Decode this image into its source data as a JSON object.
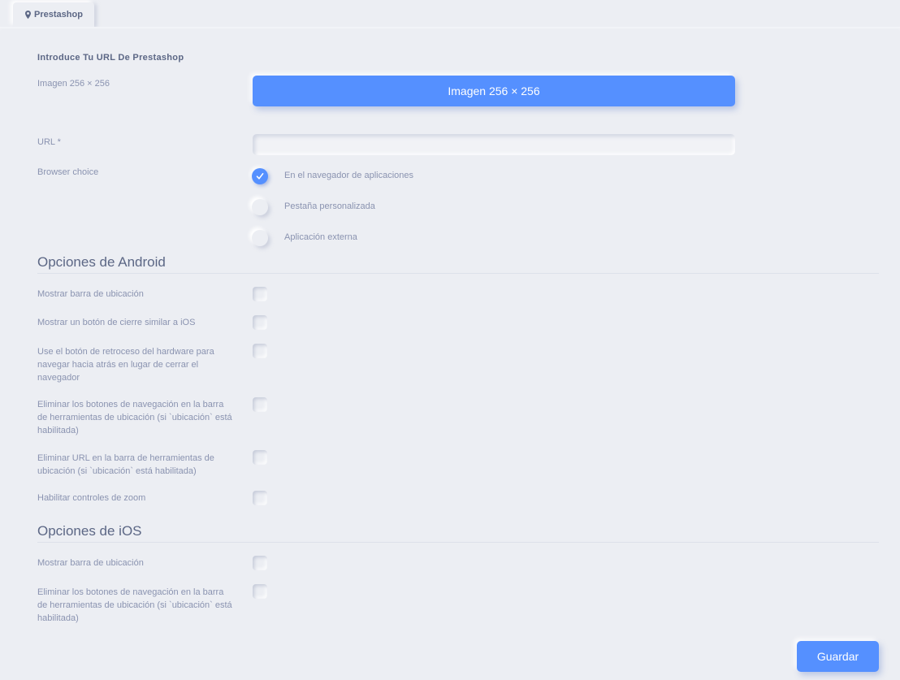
{
  "tab": {
    "label": "Prestashop",
    "icon": "map-pin-icon"
  },
  "form": {
    "heading": "Introduce Tu URL De Prestashop",
    "image_label": "Imagen 256 × 256",
    "image_button": "Imagen 256 × 256",
    "url_label": "URL *",
    "url_value": "",
    "browser_label": "Browser choice",
    "browser_options": [
      {
        "label": "En el navegador de aplicaciones",
        "checked": true
      },
      {
        "label": "Pestaña personalizada",
        "checked": false
      },
      {
        "label": "Aplicación externa",
        "checked": false
      }
    ]
  },
  "android": {
    "title": "Opciones de Android",
    "options": [
      {
        "label": "Mostrar barra de ubicación",
        "checked": false
      },
      {
        "label": "Mostrar un botón de cierre similar a iOS",
        "checked": false
      },
      {
        "label": "Use el botón de retroceso del hardware para navegar hacia atrás en lugar de cerrar el navegador",
        "checked": false
      },
      {
        "label": "Eliminar los botones de navegación en la barra de herramientas de ubicación (si `ubicación` está habilitada)",
        "checked": false
      },
      {
        "label": "Eliminar URL en la barra de herramientas de ubicación (si `ubicación` está habilitada)",
        "checked": false
      },
      {
        "label": "Habilitar controles de zoom",
        "checked": false
      }
    ]
  },
  "ios": {
    "title": "Opciones de iOS",
    "options": [
      {
        "label": "Mostrar barra de ubicación",
        "checked": false
      },
      {
        "label": "Eliminar los botones de navegación en la barra de herramientas de ubicación (si `ubicación` está habilitada)",
        "checked": false
      }
    ]
  },
  "save_button": "Guardar",
  "colors": {
    "accent": "#5590ff",
    "background": "#eceef3",
    "text": "#8a93b0",
    "heading": "#5c6785"
  }
}
